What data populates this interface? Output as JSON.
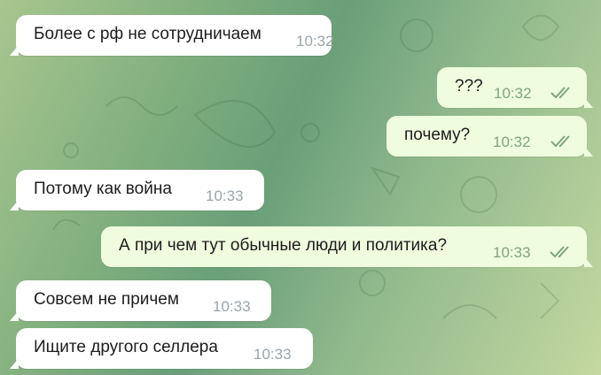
{
  "chat": {
    "messages": [
      {
        "text": "Более с рф не сотрудничаем",
        "time": "10:32",
        "direction": "incoming",
        "status": ""
      },
      {
        "text": "???",
        "time": "10:32",
        "direction": "outgoing",
        "status": "read"
      },
      {
        "text": "почему?",
        "time": "10:32",
        "direction": "outgoing",
        "status": "read"
      },
      {
        "text": "Потому как война",
        "time": "10:33",
        "direction": "incoming",
        "status": ""
      },
      {
        "text": "А при чем тут обычные люди и политика?",
        "time": "10:33",
        "direction": "outgoing",
        "status": "read"
      },
      {
        "text": "Совсем не причем",
        "time": "10:33",
        "direction": "incoming",
        "status": ""
      },
      {
        "text": "Ищите другого селлера",
        "time": "10:33",
        "direction": "incoming",
        "status": ""
      }
    ],
    "icons": {
      "read_status": "double-check-icon"
    },
    "colors": {
      "incoming_bubble": "#ffffff",
      "outgoing_bubble": "#effdde",
      "check": "#7fa57d"
    }
  }
}
